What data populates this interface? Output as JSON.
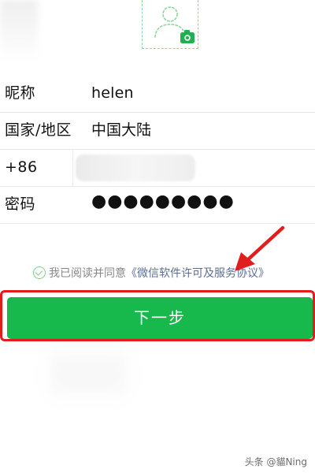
{
  "profile_form": {
    "nickname_label": "昵称",
    "nickname_value": "helen",
    "region_label": "国家/地区",
    "region_value": "中国大陆",
    "phone_prefix": "+86",
    "password_label": "密码",
    "password_value": "●●●●●●●●●"
  },
  "agreement": {
    "text": "我已阅读并同意",
    "link": "《微信软件许可及服务协议》"
  },
  "actions": {
    "next_button": "下一步"
  },
  "watermark": {
    "text": "头条 @貓Ning"
  },
  "icons": {
    "avatar": "user-avatar-placeholder-icon",
    "camera": "camera-icon",
    "check": "check-circle-icon",
    "annotation": "annotation-arrow-icon"
  },
  "colors": {
    "primary_green": "#17b84c",
    "dashed_green": "#8fd59b",
    "highlight_red": "#e21d1d",
    "link_blue": "#5b6e97"
  }
}
